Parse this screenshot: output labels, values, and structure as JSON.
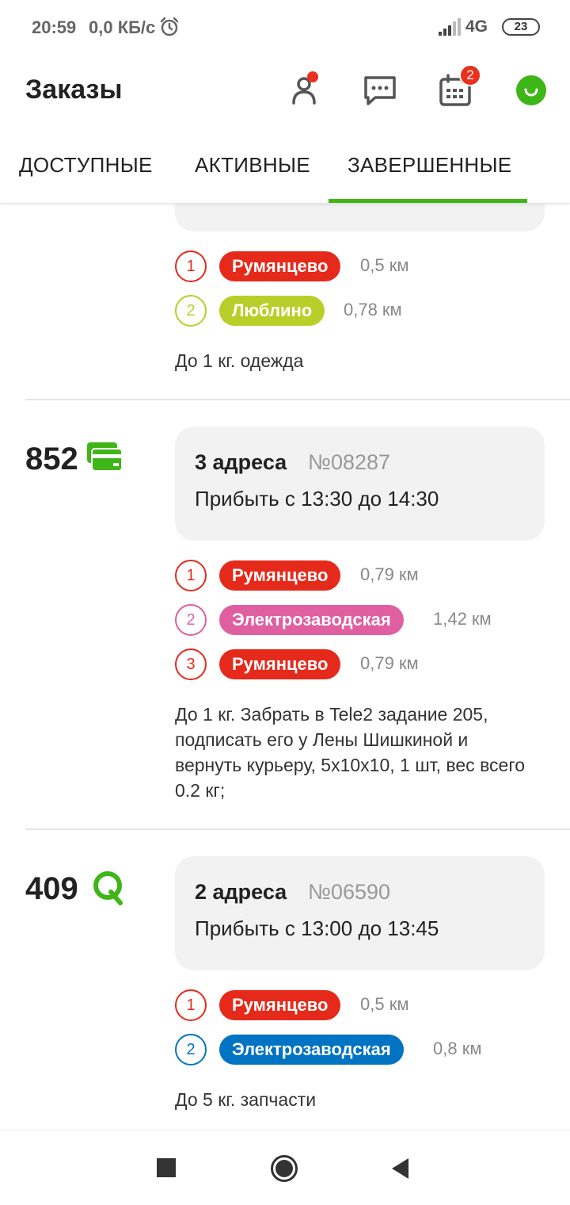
{
  "status_bar": {
    "time": "20:59",
    "speed": "0,0 КБ/с",
    "network": "4G",
    "battery": "23"
  },
  "header": {
    "title": "Заказы",
    "calendar_badge": "2"
  },
  "tabs": [
    {
      "label": "ДОСТУПНЫЕ",
      "active": false
    },
    {
      "label": "АКТИВНЫЕ",
      "active": false
    },
    {
      "label": "ЗАВЕРШЕННЫЕ",
      "active": true
    }
  ],
  "colors": {
    "accent": "#3fb618",
    "red": "#e52a1b",
    "lime": "#b8cf2a",
    "pink": "#df5fa0",
    "blue": "#0073c2"
  },
  "orders": [
    {
      "stops": [
        {
          "n": "1",
          "station": "Румянцево",
          "distance": "0,5 км",
          "color": "#e52a1b"
        },
        {
          "n": "2",
          "station": "Люблино",
          "distance": "0,78 км",
          "color": "#b8cf2a"
        }
      ],
      "description": "До 1 кг. одежда"
    },
    {
      "price": "852",
      "payment_icon": "card-icon",
      "addresses": "3 адреса",
      "number": "№08287",
      "time_window": "Прибыть с 13:30 до 14:30",
      "stops": [
        {
          "n": "1",
          "station": "Румянцево",
          "distance": "0,79 км",
          "color": "#e52a1b"
        },
        {
          "n": "2",
          "station": "Электрозаводская",
          "distance": "1,42 км",
          "color": "#df5fa0"
        },
        {
          "n": "3",
          "station": "Румянцево",
          "distance": "0,79 км",
          "color": "#e52a1b"
        }
      ],
      "description": "До 1 кг. Забрать в Tele2 задание 205, подписать его у Лены Шишкиной и вернуть курьеру, 5х10х10, 1 шт, вес всего 0.2 кг;"
    },
    {
      "price": "409",
      "payment_icon": "qiwi-icon",
      "addresses": "2 адреса",
      "number": "№06590",
      "time_window": "Прибыть с 13:00 до 13:45",
      "stops": [
        {
          "n": "1",
          "station": "Румянцево",
          "distance": "0,5 км",
          "color": "#e52a1b"
        },
        {
          "n": "2",
          "station": "Электрозаводская",
          "distance": "0,8 км",
          "color": "#0073c2"
        }
      ],
      "description": "До 5 кг. запчасти"
    }
  ]
}
